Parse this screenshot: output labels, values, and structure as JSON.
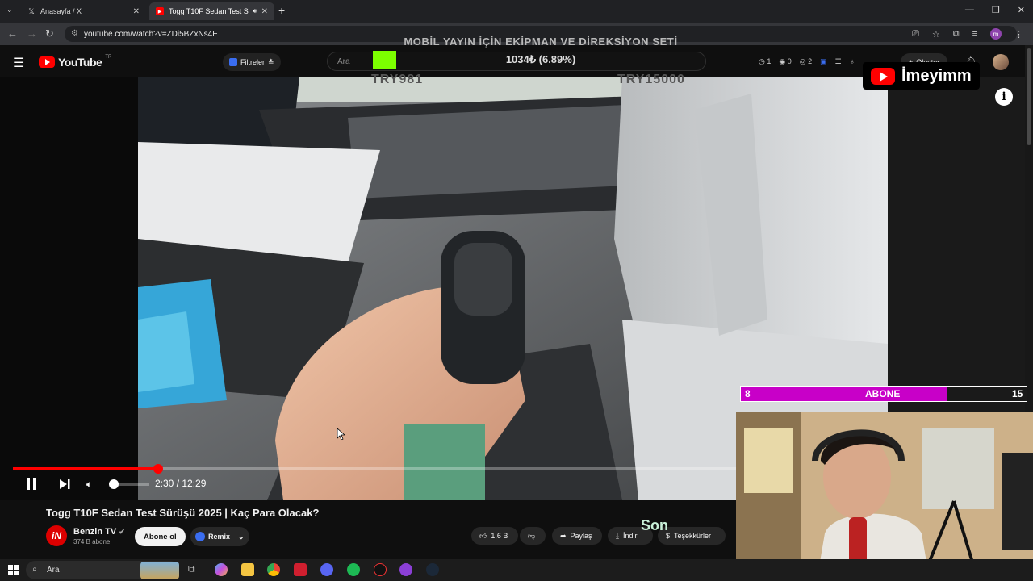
{
  "browser": {
    "tabs": [
      {
        "label": "Anasayfa / X",
        "icon": "x-logo-icon"
      },
      {
        "label": "Togg T10F Sedan Test Sürüş",
        "icon": "youtube-favicon-icon",
        "active": true
      }
    ],
    "url": "youtube.com/watch?v=ZDi5BZxNs4E"
  },
  "youtube": {
    "logo_text": "YouTube",
    "region": "TR",
    "filters_label": "Filtreler",
    "search_placeholder": "Ara",
    "ext_counts": {
      "a": "1",
      "b": "0",
      "c": "2"
    },
    "create_label": "Oluştur"
  },
  "overlay": {
    "goal_title": "MOBİL YAYIN İÇİN EKİPMAN VE DİREKSİYON SETİ",
    "goal_value": "1034₺ (6.89%)",
    "goal_progress": 0.0689,
    "goal_start": "TRY981",
    "goal_end": "TRY15000",
    "brand_name": "İmeyimm",
    "sub_counter": {
      "current": "8",
      "label": "ABONE",
      "goal": "15",
      "fill_fraction": 0.72
    },
    "bottom_label": "Son"
  },
  "player": {
    "current_time": "2:30",
    "duration": "12:29",
    "progress": 0.2,
    "volume": 0.0
  },
  "video": {
    "title": "Togg T10F Sedan Test Sürüşü 2025 | Kaç Para Olacak?",
    "channel_name": "Benzin TV",
    "channel_avatar_text": "iN",
    "subscribers": "374 B abone",
    "subscribe_label": "Abone ol",
    "remix_label": "Remix",
    "likes": "1,6 B",
    "share_label": "Paylaş",
    "download_label": "İndir",
    "thanks_label": "Teşekkürler"
  },
  "taskbar": {
    "search_placeholder": "Ara"
  },
  "colors": {
    "yt_red": "#ff0000",
    "goal_green": "#7cff00",
    "sub_magenta": "#c800c8"
  }
}
